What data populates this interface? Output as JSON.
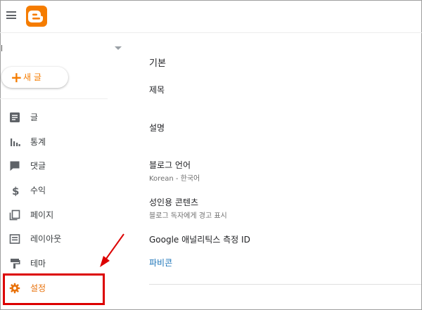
{
  "header": {
    "menu_icon": "hamburger-menu-icon",
    "logo_icon": "blogger-logo-icon",
    "brand_color": "#f57c00"
  },
  "blog_selector": {
    "value": ""
  },
  "new_post": {
    "plus": "+",
    "label": "새 글"
  },
  "sidebar": {
    "items": [
      {
        "icon": "posts-icon",
        "label": "글"
      },
      {
        "icon": "stats-icon",
        "label": "통계"
      },
      {
        "icon": "comments-icon",
        "label": "댓글"
      },
      {
        "icon": "earnings-icon",
        "label": "수익"
      },
      {
        "icon": "pages-icon",
        "label": "페이지"
      },
      {
        "icon": "layout-icon",
        "label": "레이아웃"
      },
      {
        "icon": "theme-icon",
        "label": "테마"
      },
      {
        "icon": "settings-gear-icon",
        "label": "설정",
        "active": true
      }
    ],
    "active_color": "#e8710a"
  },
  "settings": {
    "section_title": "기본",
    "title_label": "제목",
    "description_label": "설명",
    "language": {
      "label": "블로그 언어",
      "value": "Korean - 한국어"
    },
    "adult_content": {
      "label": "성인용 콘텐츠",
      "value": "블로그 독자에게 경고 표시"
    },
    "analytics_label": "Google 애널리틱스 측정 ID",
    "favicon_label": "파비콘"
  },
  "annotation": {
    "color": "#dc0000"
  }
}
